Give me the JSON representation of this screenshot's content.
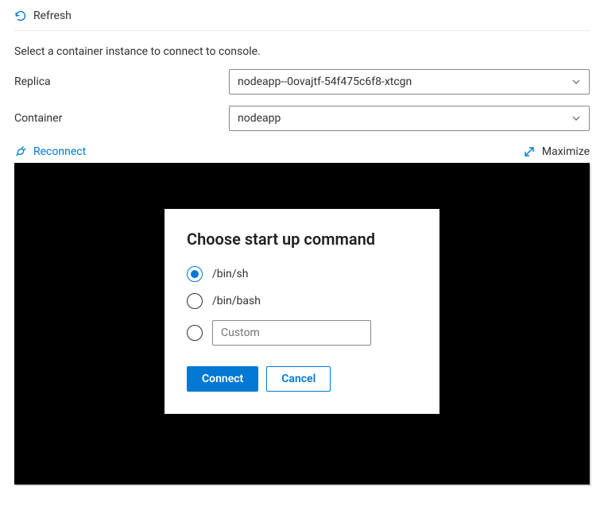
{
  "toolbar": {
    "refresh_label": "Refresh"
  },
  "instruction": "Select a container instance to connect to console.",
  "form": {
    "replica_label": "Replica",
    "replica_value": "nodeapp--0ovajtf-54f475c6f8-xtcgn",
    "container_label": "Container",
    "container_value": "nodeapp"
  },
  "console": {
    "reconnect_label": "Reconnect",
    "maximize_label": "Maximize"
  },
  "dialog": {
    "title": "Choose start up command",
    "options": {
      "binsh": "/bin/sh",
      "binbash": "/bin/bash",
      "custom_placeholder": "Custom"
    },
    "selected": "binsh",
    "connect_label": "Connect",
    "cancel_label": "Cancel"
  }
}
